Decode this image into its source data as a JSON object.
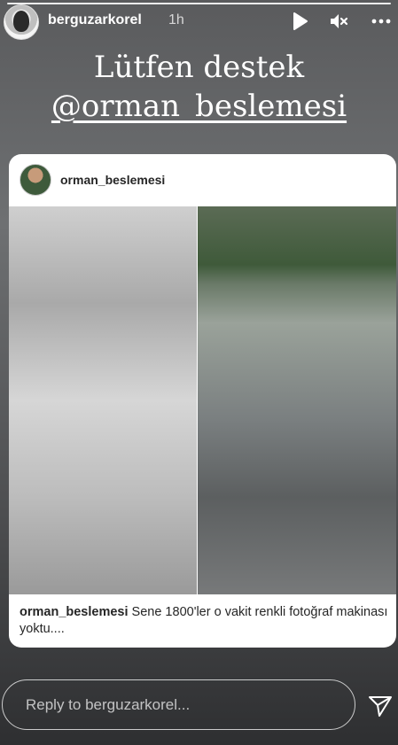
{
  "story": {
    "username": "berguzarkorel",
    "time": "1h"
  },
  "headline": {
    "line1": "Lütfen destek",
    "line2": "@orman_beslemesi"
  },
  "post": {
    "username": "orman_beslemesi",
    "caption_user": "orman_beslemesi",
    "caption_text": " Sene 1800'ler o vakit renkli fotoğraf makinası yoktu...."
  },
  "reply": {
    "placeholder": "Reply to berguzarkorel..."
  },
  "icons": {
    "play": "play-icon",
    "mute": "mute-icon",
    "more": "more-icon",
    "send": "send-icon"
  }
}
